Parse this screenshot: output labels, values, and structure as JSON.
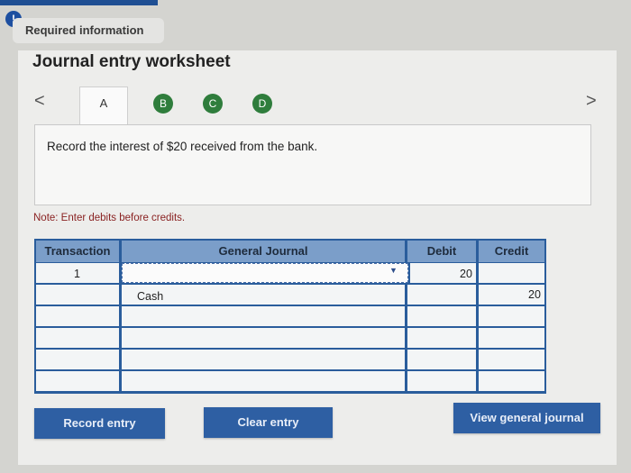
{
  "alert_icon": "!",
  "required_label": "Required information",
  "worksheet_title": "Journal entry worksheet",
  "nav": {
    "prev": "<",
    "next": ">"
  },
  "tabs": [
    {
      "label": "A"
    },
    {
      "label": "B"
    },
    {
      "label": "C"
    },
    {
      "label": "D"
    }
  ],
  "instruction": "Record the interest of $20 received from the bank.",
  "note": "Note: Enter debits before credits.",
  "table": {
    "headers": {
      "transaction": "Transaction",
      "general_journal": "General Journal",
      "debit": "Debit",
      "credit": "Credit"
    },
    "rows": [
      {
        "transaction": "1",
        "account": "",
        "debit": "20",
        "credit": ""
      },
      {
        "transaction": "",
        "account": "Cash",
        "debit": "",
        "credit": "20"
      },
      {
        "transaction": "",
        "account": "",
        "debit": "",
        "credit": ""
      },
      {
        "transaction": "",
        "account": "",
        "debit": "",
        "credit": ""
      },
      {
        "transaction": "",
        "account": "",
        "debit": "",
        "credit": ""
      },
      {
        "transaction": "",
        "account": "",
        "debit": "",
        "credit": ""
      }
    ]
  },
  "buttons": {
    "record": "Record entry",
    "clear": "Clear entry",
    "view": "View general journal"
  },
  "colors": {
    "accent": "#2e5fa3",
    "tab_green": "#2f7d3c",
    "header_blue": "#7b9ec9",
    "note_red": "#8a2222"
  }
}
